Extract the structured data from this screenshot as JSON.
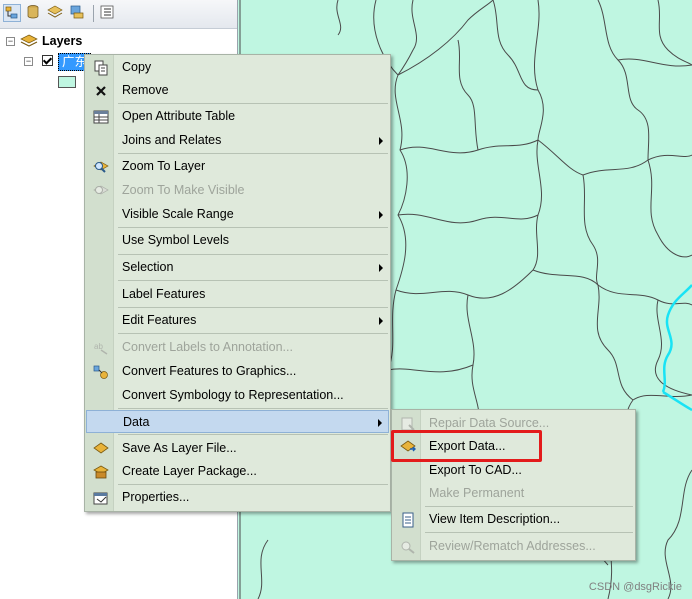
{
  "toc": {
    "root_label": "Layers",
    "layer_label": "广东"
  },
  "context_menu": {
    "items": [
      {
        "label": "Copy",
        "icon": "copy-icon",
        "enabled": true,
        "submenu": false
      },
      {
        "label": "Remove",
        "icon": "remove-x-icon",
        "enabled": true,
        "submenu": false
      },
      {
        "label": "Open Attribute Table",
        "icon": "table-icon",
        "enabled": true,
        "submenu": false
      },
      {
        "label": "Joins and Relates",
        "icon": "",
        "enabled": true,
        "submenu": true
      },
      {
        "label": "Zoom To Layer",
        "icon": "zoom-to-layer-icon",
        "enabled": true,
        "submenu": false
      },
      {
        "label": "Zoom To Make Visible",
        "icon": "zoom-visible-icon",
        "enabled": false,
        "submenu": false
      },
      {
        "label": "Visible Scale Range",
        "icon": "",
        "enabled": true,
        "submenu": true
      },
      {
        "label": "Use Symbol Levels",
        "icon": "",
        "enabled": true,
        "submenu": false
      },
      {
        "label": "Selection",
        "icon": "",
        "enabled": true,
        "submenu": true
      },
      {
        "label": "Label Features",
        "icon": "",
        "enabled": true,
        "submenu": false
      },
      {
        "label": "Edit Features",
        "icon": "",
        "enabled": true,
        "submenu": true
      },
      {
        "label": "Convert Labels to Annotation...",
        "icon": "convert-labels-icon",
        "enabled": false,
        "submenu": false
      },
      {
        "label": "Convert Features to Graphics...",
        "icon": "convert-graphics-icon",
        "enabled": true,
        "submenu": false
      },
      {
        "label": "Convert Symbology to Representation...",
        "icon": "",
        "enabled": true,
        "submenu": false
      },
      {
        "label": "Data",
        "icon": "",
        "enabled": true,
        "submenu": true,
        "highlighted": true
      },
      {
        "label": "Save As Layer File...",
        "icon": "layer-file-icon",
        "enabled": true,
        "submenu": false
      },
      {
        "label": "Create Layer Package...",
        "icon": "layer-package-icon",
        "enabled": true,
        "submenu": false
      },
      {
        "label": "Properties...",
        "icon": "properties-icon",
        "enabled": true,
        "submenu": false
      }
    ]
  },
  "data_submenu": {
    "items": [
      {
        "label": "Repair Data Source...",
        "icon": "repair-source-icon",
        "enabled": false
      },
      {
        "label": "Export Data...",
        "icon": "export-data-icon",
        "enabled": true
      },
      {
        "label": "Export To CAD...",
        "icon": "",
        "enabled": true
      },
      {
        "label": "Make Permanent",
        "icon": "",
        "enabled": false
      },
      {
        "label": "View Item Description...",
        "icon": "item-description-icon",
        "enabled": true
      },
      {
        "label": "Review/Rematch Addresses...",
        "icon": "rematch-addresses-icon",
        "enabled": false
      }
    ]
  },
  "watermark": "CSDN @dsgRickie",
  "colors": {
    "map_fill": "#bff6e1",
    "boundary": "#4a4a4a",
    "highlight_boundary": "#19e3f5",
    "annotation_box": "#e31b1b"
  }
}
